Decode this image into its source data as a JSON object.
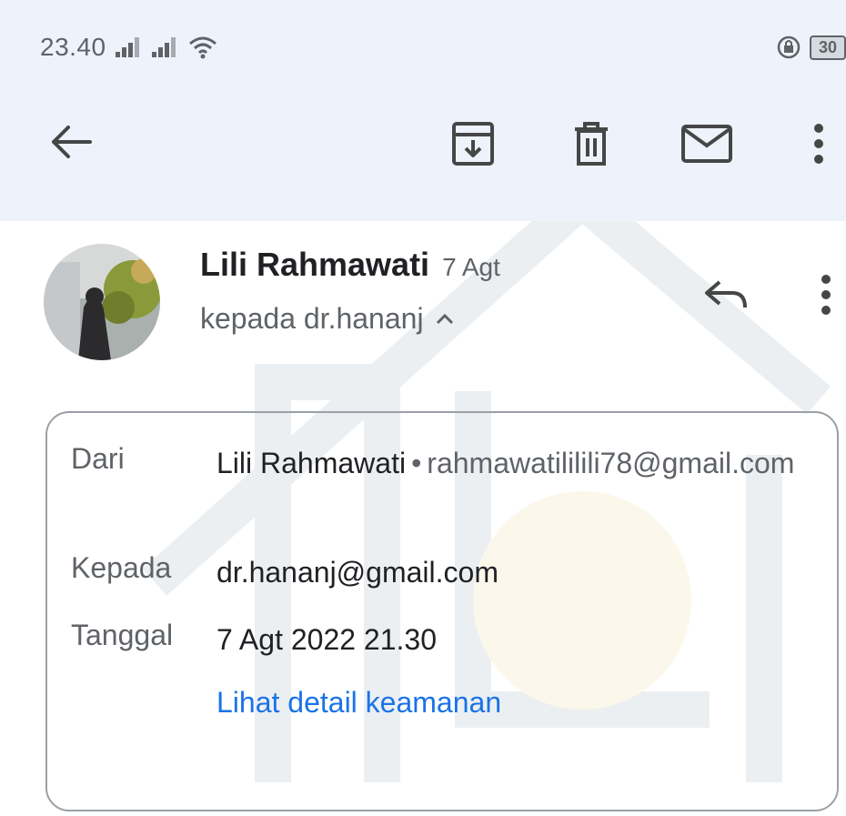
{
  "status_bar": {
    "time": "23.40",
    "battery": "30"
  },
  "toolbar": {
    "icons": [
      "back-arrow-icon",
      "archive-icon",
      "delete-icon",
      "mail-icon",
      "more-vert-icon"
    ]
  },
  "message": {
    "sender_name": "Lili Rahmawati",
    "date": "7 Agt",
    "to_summary": "kepada dr.hananj"
  },
  "details": {
    "from_label": "Dari",
    "from_name": "Lili Rahmawati",
    "from_email": "rahmawatililili78@gmail.com",
    "to_label": "Kepada",
    "to_email": "dr.hananj@gmail.com",
    "date_label": "Tanggal",
    "date_value": "7 Agt 2022 21.30",
    "security_link": "Lihat detail keamanan"
  },
  "colors": {
    "topbar_bg": "#eef3fb",
    "link": "#1a73e8",
    "text_primary": "#202124",
    "text_secondary": "#5f6368"
  }
}
